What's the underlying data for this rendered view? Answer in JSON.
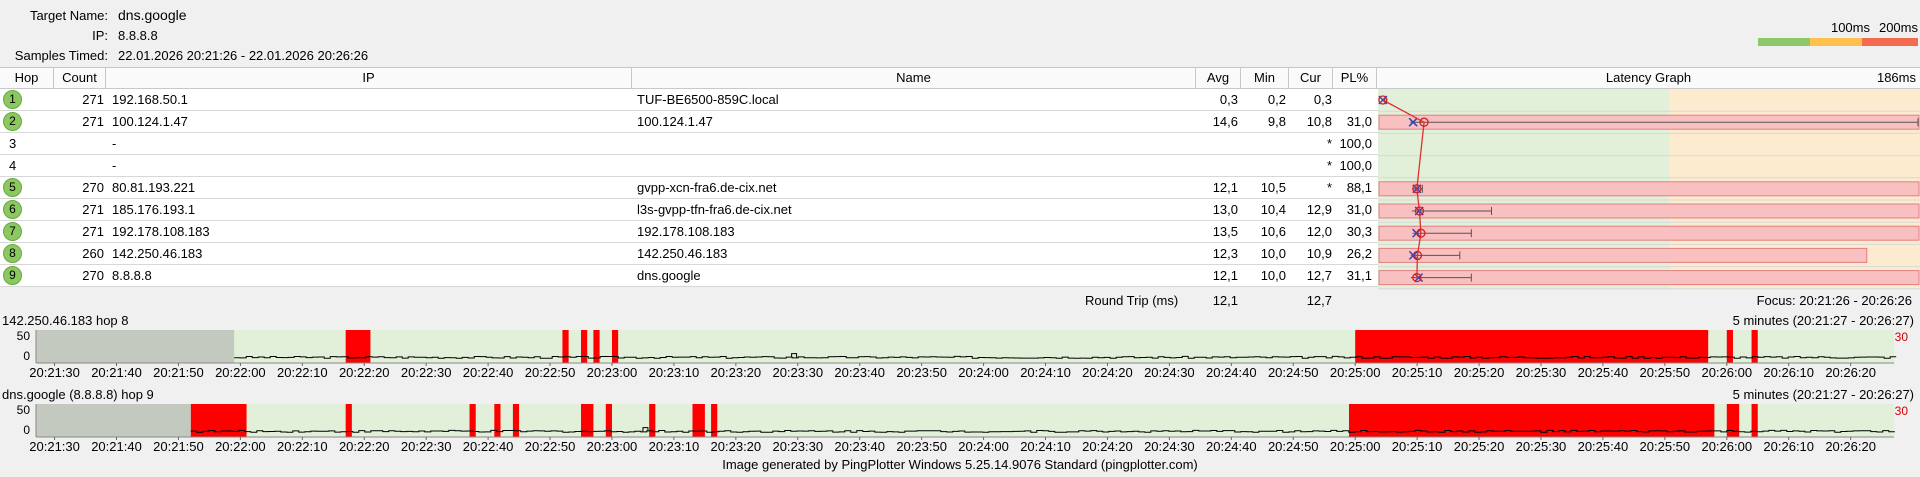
{
  "info": {
    "target_label": "Target Name:",
    "target_value": "dns.google",
    "ip_label": "IP:",
    "ip_value": "8.8.8.8",
    "samples_label": "Samples Timed:",
    "samples_value": "22.01.2026 20:21:26 - 22.01.2026 20:26:26"
  },
  "scale": {
    "low": "100ms",
    "high": "200ms",
    "colors": [
      "#8dc86a",
      "#ffc04d",
      "#f26b4f"
    ]
  },
  "table": {
    "headers": {
      "hop": "Hop",
      "count": "Count",
      "ip": "IP",
      "name": "Name",
      "avg": "Avg",
      "min": "Min",
      "cur": "Cur",
      "pl": "PL%",
      "graph": "Latency Graph",
      "graph_max": "186ms"
    },
    "rows": [
      {
        "hop": "1",
        "count": "271",
        "ip": "192.168.50.1",
        "name": "TUF-BE6500-859C.local",
        "avg": "0,3",
        "min": "0,2",
        "cur": "0,3",
        "pl": "",
        "active": true,
        "avg_ms": 0.3,
        "min_ms": 0.2,
        "cur_ms": 0.3,
        "max_ms": 1.0,
        "loss": 0
      },
      {
        "hop": "2",
        "count": "271",
        "ip": "100.124.1.47",
        "name": "100.124.1.47",
        "avg": "14,6",
        "min": "9,8",
        "cur": "10,8",
        "pl": "31,0",
        "active": true,
        "avg_ms": 14.6,
        "min_ms": 9.8,
        "cur_ms": 10.8,
        "max_ms": 186,
        "loss": 31.0
      },
      {
        "hop": "3",
        "count": "",
        "ip": "-",
        "name": "",
        "avg": "",
        "min": "",
        "cur": "*",
        "pl": "100,0",
        "active": false
      },
      {
        "hop": "4",
        "count": "",
        "ip": "-",
        "name": "",
        "avg": "",
        "min": "",
        "cur": "*",
        "pl": "100,0",
        "active": false
      },
      {
        "hop": "5",
        "count": "270",
        "ip": "80.81.193.221",
        "name": "gvpp-xcn-fra6.de-cix.net",
        "avg": "12,1",
        "min": "10,5",
        "cur": "*",
        "pl": "88,1",
        "active": true,
        "avg_ms": 12.1,
        "min_ms": 10.5,
        "cur_ms": 12.1,
        "max_ms": 14,
        "loss": 88.1
      },
      {
        "hop": "6",
        "count": "271",
        "ip": "185.176.193.1",
        "name": "l3s-gvpp-tfn-fra6.de-cix.net",
        "avg": "13,0",
        "min": "10,4",
        "cur": "12,9",
        "pl": "31,0",
        "active": true,
        "avg_ms": 13.0,
        "min_ms": 10.4,
        "cur_ms": 12.9,
        "max_ms": 38,
        "loss": 31.0
      },
      {
        "hop": "7",
        "count": "271",
        "ip": "192.178.108.183",
        "name": "192.178.108.183",
        "avg": "13,5",
        "min": "10,6",
        "cur": "12,0",
        "pl": "30,3",
        "active": true,
        "avg_ms": 13.5,
        "min_ms": 10.6,
        "cur_ms": 12.0,
        "max_ms": 31,
        "loss": 30.3
      },
      {
        "hop": "8",
        "count": "260",
        "ip": "142.250.46.183",
        "name": "142.250.46.183",
        "avg": "12,3",
        "min": "10,0",
        "cur": "10,9",
        "pl": "26,2",
        "active": true,
        "avg_ms": 12.3,
        "min_ms": 10.0,
        "cur_ms": 10.9,
        "max_ms": 27,
        "loss": 26.2
      },
      {
        "hop": "9",
        "count": "270",
        "ip": "8.8.8.8",
        "name": "dns.google",
        "avg": "12,1",
        "min": "10,0",
        "cur": "12,7",
        "pl": "31,1",
        "active": true,
        "avg_ms": 12.1,
        "min_ms": 10.0,
        "cur_ms": 12.7,
        "max_ms": 31,
        "loss": 31.1
      }
    ],
    "round_trip_label": "Round Trip (ms)",
    "round_trip_avg": "12,1",
    "round_trip_cur": "12,7",
    "focus": "Focus: 20:21:26 - 20:26:26"
  },
  "timegraphs": [
    {
      "title": "142.250.46.183 hop 8",
      "range": "5 minutes (20:21:27 - 20:26:27)",
      "y_ticks": [
        "50",
        "0"
      ],
      "y_max_label": "30",
      "no_data_until": "20:21:59",
      "loss_bursts": [
        [
          "20:22:17",
          "20:22:21"
        ],
        [
          "20:22:52",
          "20:22:53"
        ],
        [
          "20:22:55",
          "20:22:56"
        ],
        [
          "20:22:57",
          "20:22:58"
        ],
        [
          "20:23:00",
          "20:23:01"
        ],
        [
          "20:25:00",
          "20:25:57"
        ],
        [
          "20:26:00",
          "20:26:01"
        ],
        [
          "20:26:04",
          "20:26:05"
        ]
      ],
      "spikes": [
        [
          "20:23:29",
          7
        ]
      ]
    },
    {
      "title": "dns.google (8.8.8.8) hop 9",
      "range": "5 minutes (20:21:27 - 20:26:27)",
      "y_ticks": [
        "50",
        "0"
      ],
      "y_max_label": "30",
      "no_data_until": "20:21:52",
      "loss_bursts": [
        [
          "20:21:52",
          "20:22:01"
        ],
        [
          "20:22:17",
          "20:22:18"
        ],
        [
          "20:22:37",
          "20:22:38"
        ],
        [
          "20:22:41",
          "20:22:42"
        ],
        [
          "20:22:44",
          "20:22:45"
        ],
        [
          "20:22:55",
          "20:22:57"
        ],
        [
          "20:22:59",
          "20:23:00"
        ],
        [
          "20:23:06",
          "20:23:07"
        ],
        [
          "20:23:13",
          "20:23:15"
        ],
        [
          "20:23:16",
          "20:23:17"
        ],
        [
          "20:24:59",
          "20:25:58"
        ],
        [
          "20:26:00",
          "20:26:02"
        ],
        [
          "20:26:04",
          "20:26:05"
        ]
      ],
      "spikes": [
        [
          "20:23:05",
          7
        ]
      ]
    }
  ],
  "time_axis": [
    "20:21:30",
    "20:21:40",
    "20:21:50",
    "20:22:00",
    "20:22:10",
    "20:22:20",
    "20:22:30",
    "20:22:40",
    "20:22:50",
    "20:23:00",
    "20:23:10",
    "20:23:20",
    "20:23:30",
    "20:23:40",
    "20:23:50",
    "20:24:00",
    "20:24:10",
    "20:24:20",
    "20:24:30",
    "20:24:40",
    "20:24:50",
    "20:25:00",
    "20:25:10",
    "20:25:20",
    "20:25:30",
    "20:25:40",
    "20:25:50",
    "20:26:00",
    "20:26:10",
    "20:26:20"
  ],
  "footer": "Image generated by PingPlotter Windows 5.25.14.9076 Standard (pingplotter.com)"
}
